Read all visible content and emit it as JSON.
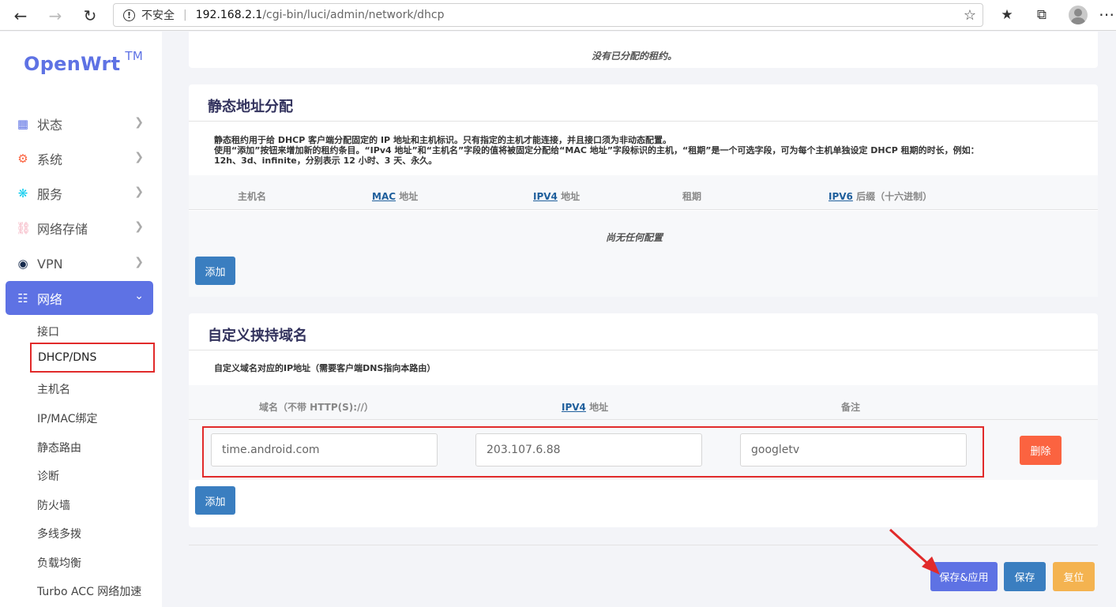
{
  "browser": {
    "back_icon": "back-arrow-icon",
    "forward_icon": "forward-arrow-icon",
    "reload_icon": "reload-icon",
    "security_label": "不安全",
    "url_host": "192.168.2.1",
    "url_path": "/cgi-bin/luci/admin/network/dhcp"
  },
  "sidebar": {
    "logo": "OpenWrt",
    "logo_tm": "TM",
    "menu": [
      {
        "label": "状态",
        "icon": "grid-icon"
      },
      {
        "label": "系统",
        "icon": "gear-icon"
      },
      {
        "label": "服务",
        "icon": "services-icon"
      },
      {
        "label": "网络存储",
        "icon": "database-icon"
      },
      {
        "label": "VPN",
        "icon": "globe-icon"
      },
      {
        "label": "网络",
        "icon": "sitemap-icon",
        "active": true
      }
    ],
    "submenu": [
      "接口",
      "DHCP/DNS",
      "主机名",
      "IP/MAC绑定",
      "静态路由",
      "诊断",
      "防火墙",
      "多线多拨",
      "负载均衡",
      "Turbo ACC 网络加速"
    ],
    "selected_submenu": "DHCP/DNS"
  },
  "leases": {
    "empty_text": "没有已分配的租约。"
  },
  "static": {
    "title": "静态地址分配",
    "desc_line1": "静态租约用于给 DHCP 客户端分配固定的 IP 地址和主机标识。只有指定的主机才能连接，并且接口须为非动态配置。",
    "desc_line2": "使用“添加”按钮来增加新的租约条目。“IPv4 地址”和“主机名”字段的值将被固定分配给“MAC 地址”字段标识的主机，“租期”是一个可选字段，可为每个主机单独设定 DHCP 租期的时长，例如：",
    "desc_line3": "12h、3d、infinite，分别表示 12 小时、3 天、永久。",
    "columns": {
      "hostname": "主机名",
      "mac_abbr": "MAC",
      "mac_rest": " 地址",
      "ipv4_abbr": "IPV4",
      "ipv4_rest": " 地址",
      "lease": "租期",
      "ipv6_abbr": "IPV6",
      "ipv6_rest": " 后缀（十六进制）"
    },
    "empty_text": "尚无任何配置",
    "add_label": "添加"
  },
  "domains": {
    "title": "自定义挟持域名",
    "desc": "自定义域名对应的IP地址（需要客户端DNS指向本路由）",
    "columns": {
      "domain": "域名（不带 HTTP(S)://）",
      "ipv4_abbr": "IPV4",
      "ipv4_rest": " 地址",
      "note": "备注"
    },
    "row": {
      "domain": "time.android.com",
      "ipv4": "203.107.6.88",
      "note": "googletv"
    },
    "delete_label": "删除",
    "add_label": "添加"
  },
  "actions": {
    "save_apply": "保存&应用",
    "save": "保存",
    "reset": "复位"
  },
  "colors": {
    "accent": "#5e72e4",
    "blue_button": "#3a7ec0",
    "delete": "#fb6340",
    "reset": "#f4b350",
    "highlight": "#e12a2a"
  }
}
